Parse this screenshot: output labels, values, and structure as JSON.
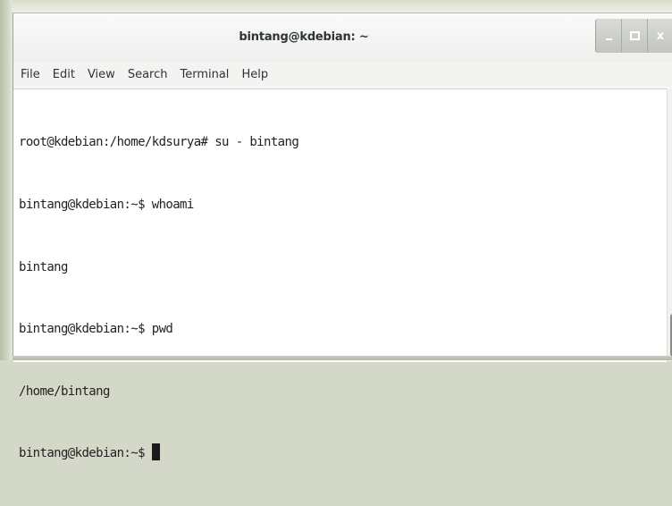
{
  "window": {
    "title": "bintang@kdebian: ~",
    "controls": {
      "minimize_icon": "minimize-icon",
      "maximize_icon": "maximize-icon",
      "close_label": "x"
    }
  },
  "menubar": {
    "items": [
      {
        "label": "File"
      },
      {
        "label": "Edit"
      },
      {
        "label": "View"
      },
      {
        "label": "Search"
      },
      {
        "label": "Terminal"
      },
      {
        "label": "Help"
      }
    ]
  },
  "terminal": {
    "lines": [
      "root@kdebian:/home/kdsurya# su - bintang",
      "bintang@kdebian:~$ whoami",
      "bintang",
      "bintang@kdebian:~$ pwd",
      "/home/bintang",
      "bintang@kdebian:~$ "
    ],
    "cursor": "block"
  },
  "colors": {
    "terminal_background": "#ffffff",
    "terminal_text": "#222222",
    "titlebar": "#f6f6f5",
    "wm_buttons": "#c9cbc5"
  }
}
